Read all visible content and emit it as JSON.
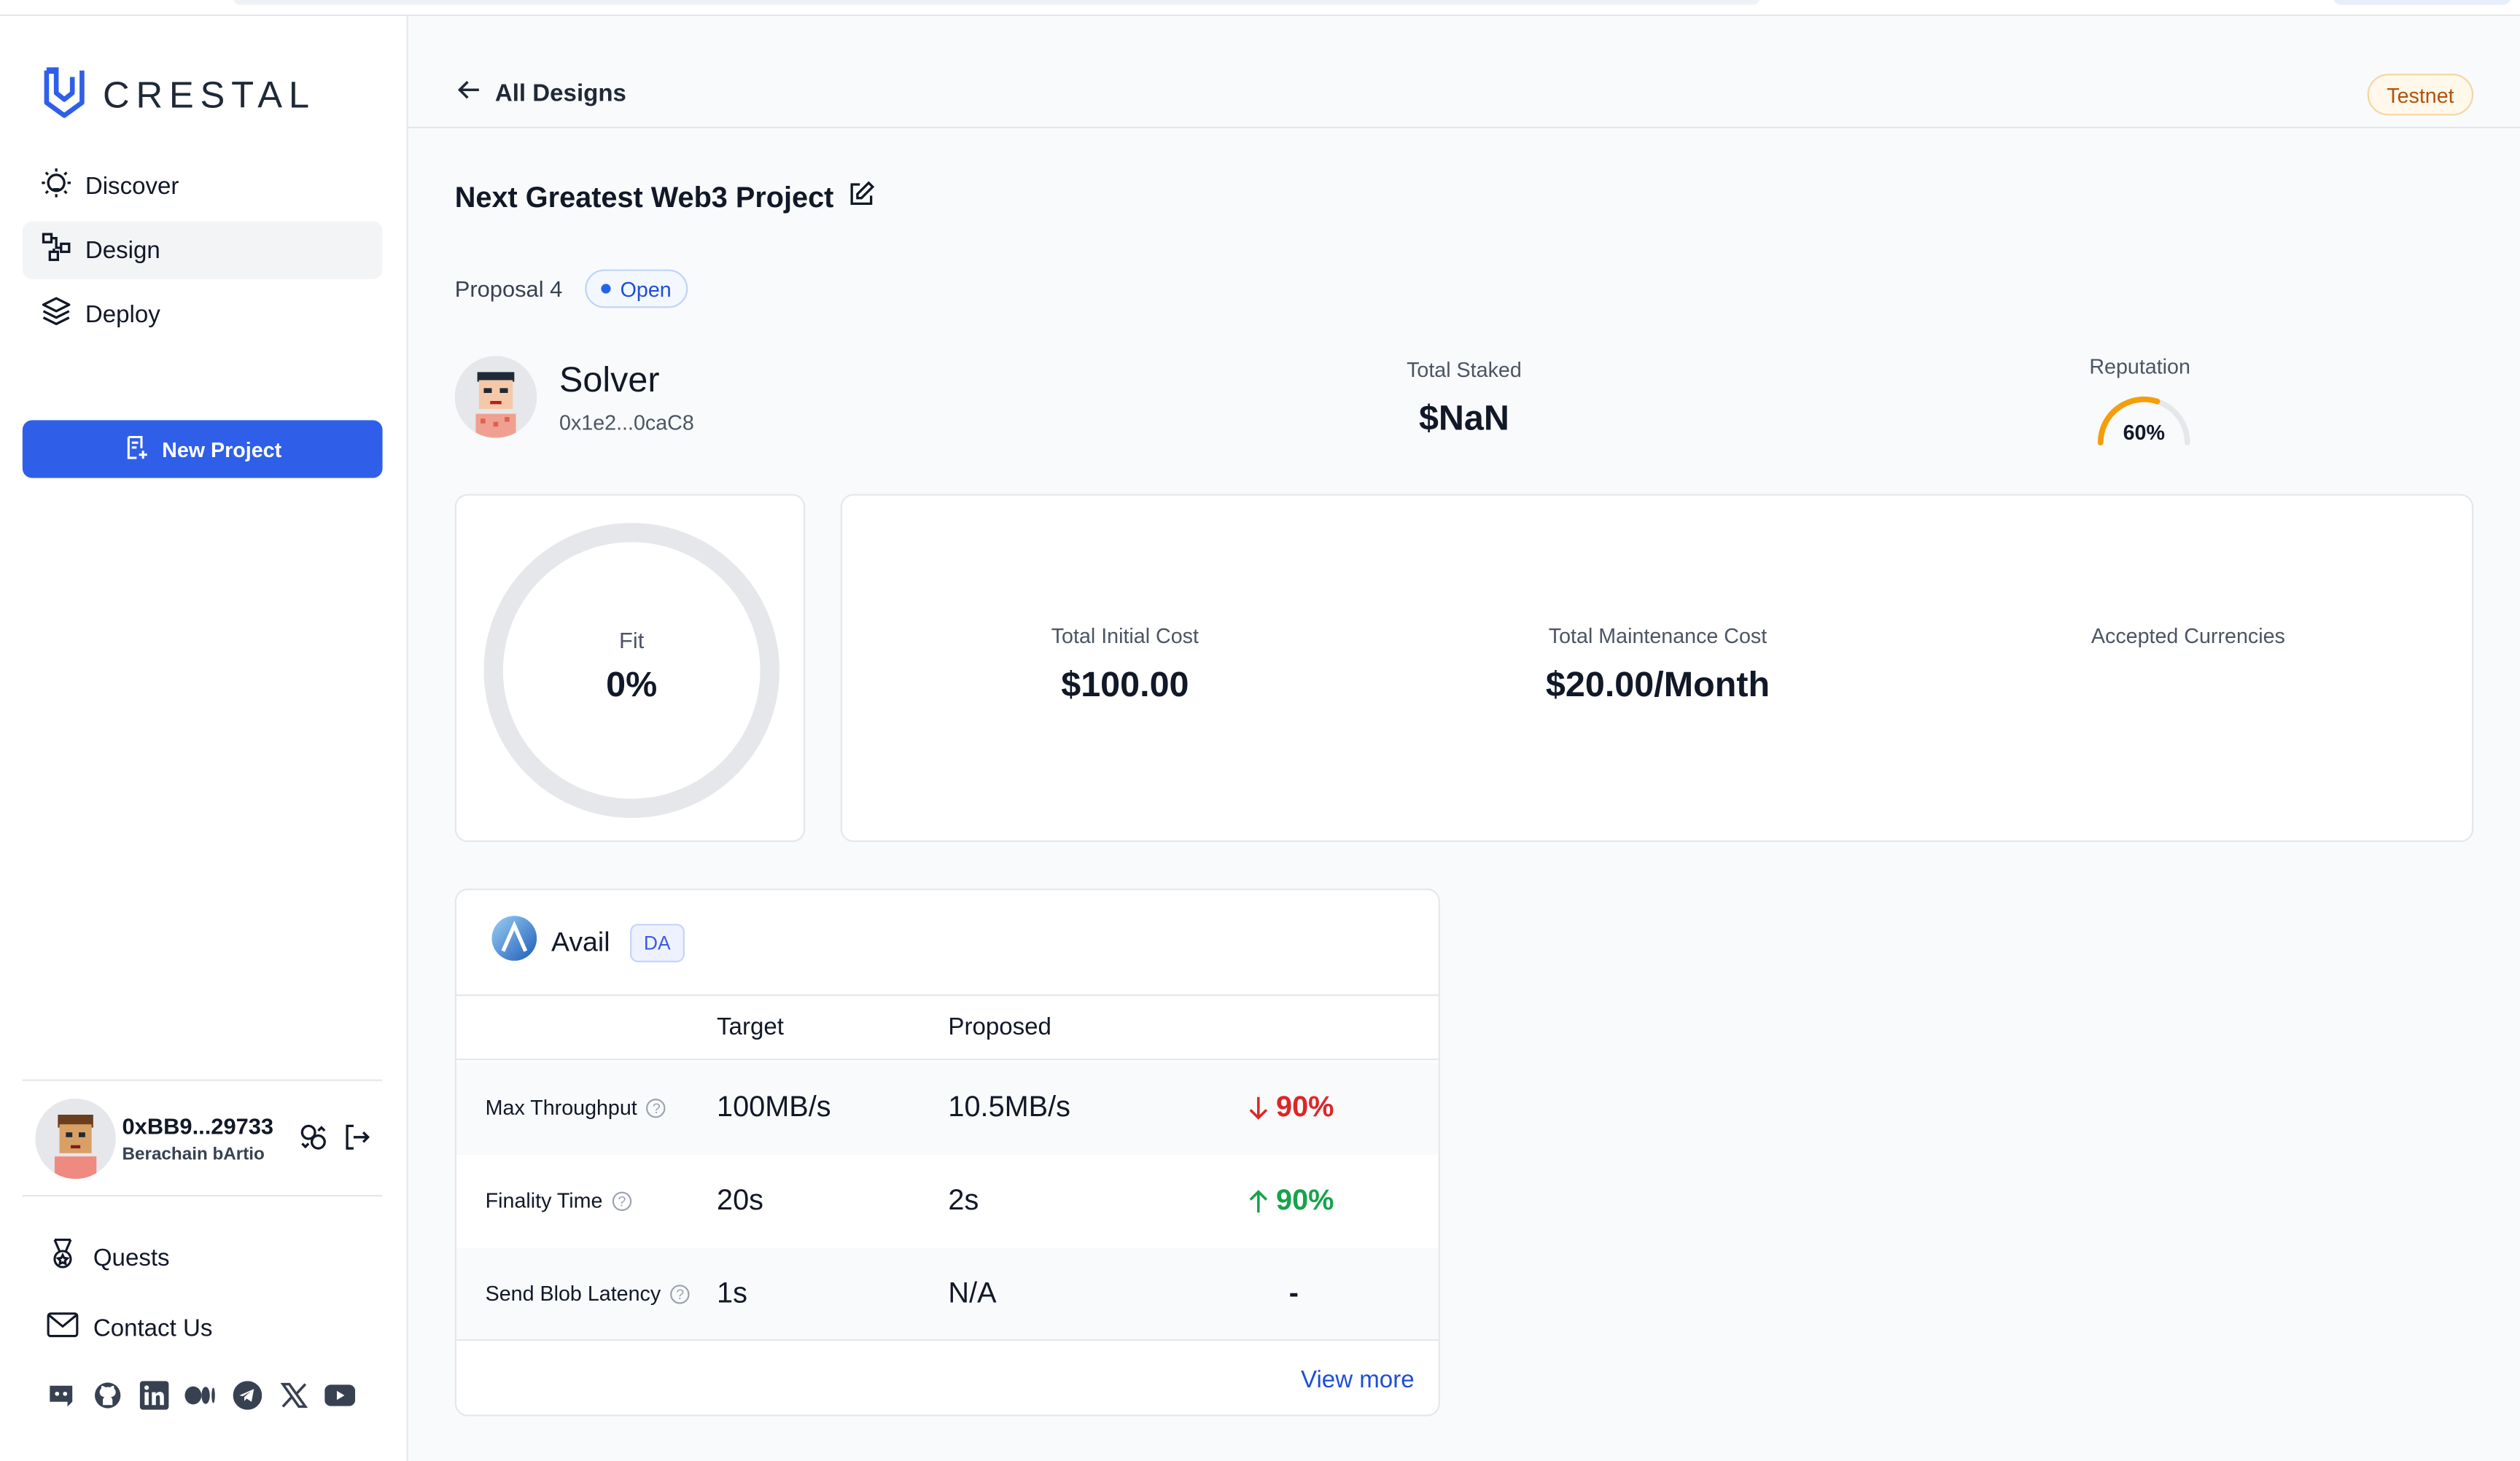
{
  "brand": {
    "name": "CRESTAL",
    "accent": "#2f5fe8"
  },
  "sidebar": {
    "nav": [
      {
        "label": "Discover",
        "icon": "bulb-icon"
      },
      {
        "label": "Design",
        "icon": "design-icon",
        "active": true
      },
      {
        "label": "Deploy",
        "icon": "layers-icon"
      }
    ],
    "new_project_label": "New Project",
    "user": {
      "address": "0xBB9...29733",
      "network": "Berachain bArtio"
    },
    "bottom_nav": [
      {
        "label": "Quests",
        "icon": "medal-icon"
      },
      {
        "label": "Contact Us",
        "icon": "mail-icon"
      }
    ],
    "socials": [
      "discord-icon",
      "github-icon",
      "linkedin-icon",
      "medium-icon",
      "telegram-icon",
      "x-icon",
      "youtube-icon"
    ]
  },
  "header": {
    "back_label": "All Designs",
    "network_badge": "Testnet"
  },
  "project": {
    "title": "Next Greatest Web3 Project",
    "proposal_label": "Proposal 4",
    "status": "Open"
  },
  "solver": {
    "name": "Solver",
    "address": "0x1e2...0caC8",
    "total_staked_label": "Total Staked",
    "total_staked_value": "$NaN",
    "reputation_label": "Reputation",
    "reputation_value": "60%",
    "reputation_fraction": 0.6
  },
  "fit": {
    "label": "Fit",
    "value": "0%"
  },
  "costs": {
    "initial_label": "Total Initial Cost",
    "initial_value": "$100.00",
    "maintenance_label": "Total Maintenance Cost",
    "maintenance_value": "$20.00/Month",
    "currencies_label": "Accepted Currencies"
  },
  "component": {
    "name": "Avail",
    "tag": "DA",
    "columns": {
      "target": "Target",
      "proposed": "Proposed"
    },
    "rows": [
      {
        "metric": "Max Throughput",
        "target": "100MB/s",
        "proposed": "10.5MB/s",
        "delta": "90%",
        "direction": "down"
      },
      {
        "metric": "Finality Time",
        "target": "20s",
        "proposed": "2s",
        "delta": "90%",
        "direction": "up"
      },
      {
        "metric": "Send Blob Latency",
        "target": "1s",
        "proposed": "N/A",
        "delta": "-",
        "direction": "none"
      }
    ],
    "view_more_label": "View more"
  }
}
